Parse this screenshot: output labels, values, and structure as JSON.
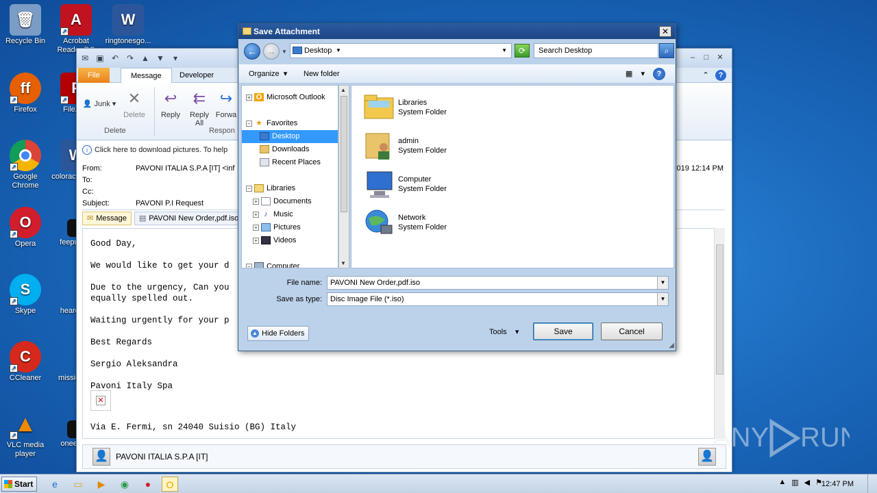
{
  "desktop": {
    "icons": [
      {
        "label": "Recycle Bin",
        "glyph": "🗑",
        "color": "#5b7ea6"
      },
      {
        "label": "Acrobat Reader DC",
        "glyph": "A",
        "color": "#c1121f"
      },
      {
        "label": "ringtonesgo...",
        "glyph": "W",
        "color": "#2b579a"
      },
      {
        "label": "Firefox",
        "glyph": "🦊",
        "color": "#e66000"
      },
      {
        "label": "FileZilla",
        "glyph": "F",
        "color": "#b30000"
      },
      {
        "label": "Google Chrome",
        "glyph": "◉",
        "color": "#2a9d4a"
      },
      {
        "label": "coloraccount...",
        "glyph": "W",
        "color": "#2b579a"
      },
      {
        "label": "Opera",
        "glyph": "O",
        "color": "#d21e2c"
      },
      {
        "label": "feepubli...",
        "glyph": "■",
        "color": "#111111"
      },
      {
        "label": "Skype",
        "glyph": "S",
        "color": "#00aff0"
      },
      {
        "label": "heardtri...",
        "glyph": "■",
        "color": "#1a5fa6"
      },
      {
        "label": "CCleaner",
        "glyph": "C",
        "color": "#d4291c"
      },
      {
        "label": "missions...",
        "glyph": "■",
        "color": "#1a5fa6"
      },
      {
        "label": "VLC media player",
        "glyph": "▲",
        "color": "#f08a00"
      },
      {
        "label": "oneeve...",
        "glyph": "■",
        "color": "#111111"
      }
    ]
  },
  "outlook": {
    "tabs": {
      "file": "File",
      "message": "Message",
      "developer": "Developer"
    },
    "ribbon": {
      "junk": "Junk",
      "delete": "Delete",
      "reply": "Reply",
      "reply_all": "Reply All",
      "forward": "Forwa",
      "group_delete": "Delete",
      "group_respond": "Respon"
    },
    "infobar": "Click here to download pictures. To help",
    "header": {
      "from_label": "From:",
      "from_value": "PAVONI ITALIA S.P.A [IT] <inf",
      "to_label": "To:",
      "cc_label": "Cc:",
      "subject_label": "Subject:",
      "subject_value": "PAVONI P.I Request",
      "date": "2019 12:14 PM"
    },
    "attachments": {
      "message_tab": "Message",
      "file": "PAVONI New Order,pdf.iso"
    },
    "body_lines": [
      "Good Day,",
      "",
      "We would like to get your d",
      "",
      "Due to the urgency, Can you",
      "equally spelled out.",
      "",
      "Waiting urgently for your p",
      "",
      "Best Regards",
      "",
      "Sergio Aleksandra",
      "",
      "Pavoni Italy Spa"
    ],
    "address_line": "Via E. Fermi, sn 24040 Suisio (BG) Italy",
    "people_name": "PAVONI ITALIA S.P.A [IT]"
  },
  "dialog": {
    "title": "Save Attachment",
    "address": "Desktop",
    "search_placeholder": "Search Desktop",
    "toolbar": {
      "organize": "Organize",
      "new_folder": "New folder"
    },
    "tree": {
      "outlook": "Microsoft Outlook",
      "favorites": "Favorites",
      "desktop": "Desktop",
      "downloads": "Downloads",
      "recent": "Recent Places",
      "libraries": "Libraries",
      "documents": "Documents",
      "music": "Music",
      "pictures": "Pictures",
      "videos": "Videos",
      "computer": "Computer"
    },
    "items": [
      {
        "name": "Libraries",
        "type": "System Folder",
        "icon": "libraries-folder-icon"
      },
      {
        "name": "admin",
        "type": "System Folder",
        "icon": "user-folder-icon"
      },
      {
        "name": "Computer",
        "type": "System Folder",
        "icon": "computer-icon"
      },
      {
        "name": "Network",
        "type": "System Folder",
        "icon": "network-icon"
      }
    ],
    "file_name_label": "File name:",
    "file_name_value": "PAVONI New Order,pdf.iso",
    "save_type_label": "Save as type:",
    "save_type_value": "Disc Image File (*.iso)",
    "hide_folders": "Hide Folders",
    "tools": "Tools",
    "save": "Save",
    "cancel": "Cancel"
  },
  "taskbar": {
    "start": "Start",
    "clock": "12:47 PM"
  },
  "watermark": "ANY RUN"
}
